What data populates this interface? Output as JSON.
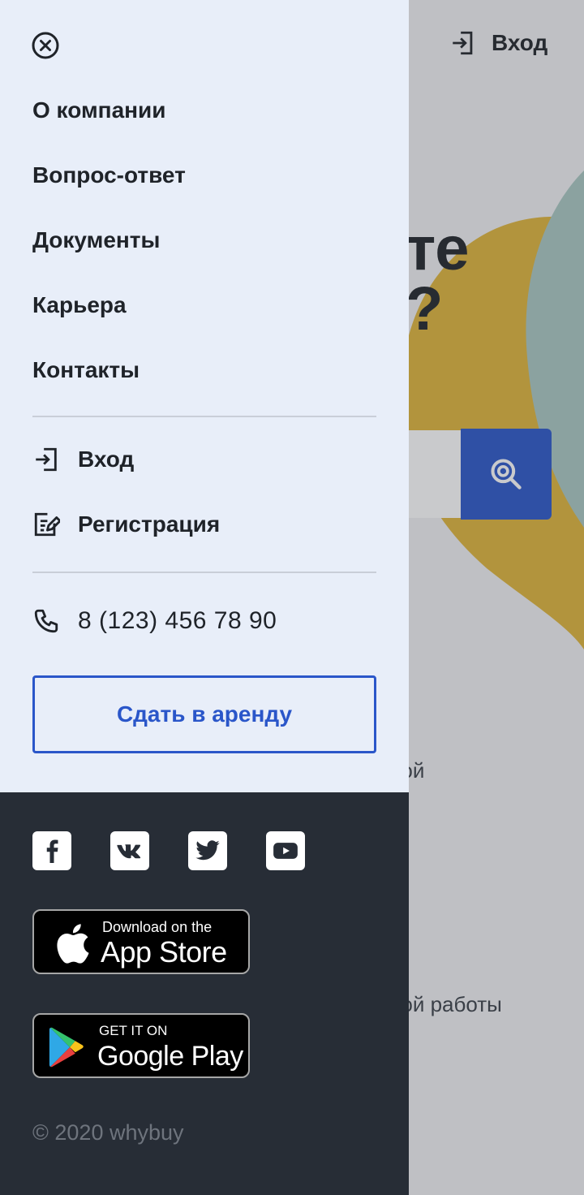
{
  "background": {
    "login_label": "Вход",
    "hero_fragment_1": "те",
    "hero_fragment_2": "?",
    "text_fragment_1": "ной",
    "text_fragment_2": "ной работы",
    "colors": {
      "blob_yellow": "#e0b43a",
      "blob_teal": "#a9c8c3",
      "accent": "#2a56c9"
    }
  },
  "drawer": {
    "close_icon": "close-circle-icon",
    "nav": [
      {
        "label": "О компании"
      },
      {
        "label": "Вопрос-ответ"
      },
      {
        "label": "Документы"
      },
      {
        "label": "Карьера"
      },
      {
        "label": "Контакты"
      }
    ],
    "login": {
      "label": "Вход",
      "icon": "login-icon"
    },
    "register": {
      "label": "Регистрация",
      "icon": "edit-icon"
    },
    "phone": {
      "number": "8 (123) 456 78 90",
      "icon": "phone-icon"
    },
    "rent_button": "Сдать в аренду",
    "social": [
      "facebook-icon",
      "vk-icon",
      "twitter-icon",
      "youtube-icon"
    ],
    "app_store": {
      "small": "Download on the",
      "big": "App Store"
    },
    "google_play": {
      "small": "GET IT ON",
      "big": "Google Play"
    },
    "copyright": "© 2020 whybuy",
    "colors": {
      "top_bg": "#e8eef9",
      "bottom_bg": "#272d36",
      "accent": "#2a56c9"
    }
  }
}
